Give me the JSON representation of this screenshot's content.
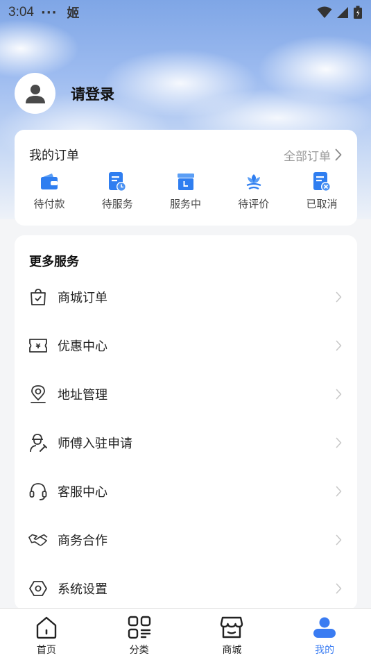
{
  "status_bar": {
    "time": "3:04",
    "dots": "···",
    "app_badge": "姬"
  },
  "profile": {
    "login_text": "请登录"
  },
  "orders": {
    "title": "我的订单",
    "all_label": "全部订单",
    "items": [
      {
        "label": "待付款",
        "icon": "wallet-icon"
      },
      {
        "label": "待服务",
        "icon": "clipboard-clock-icon"
      },
      {
        "label": "服务中",
        "icon": "box-icon"
      },
      {
        "label": "待评价",
        "icon": "flower-icon"
      },
      {
        "label": "已取消",
        "icon": "document-cancel-icon"
      }
    ]
  },
  "services": {
    "title": "更多服务",
    "items": [
      {
        "label": "商城订单",
        "icon": "shopping-bag-icon"
      },
      {
        "label": "优惠中心",
        "icon": "coupon-icon"
      },
      {
        "label": "地址管理",
        "icon": "location-pin-icon"
      },
      {
        "label": "师傅入驻申请",
        "icon": "worker-icon"
      },
      {
        "label": "客服中心",
        "icon": "headset-icon"
      },
      {
        "label": "商务合作",
        "icon": "handshake-icon"
      },
      {
        "label": "系统设置",
        "icon": "settings-hexagon-icon"
      }
    ]
  },
  "tabs": [
    {
      "label": "首页",
      "icon": "home-icon"
    },
    {
      "label": "分类",
      "icon": "category-icon"
    },
    {
      "label": "商城",
      "icon": "store-icon"
    },
    {
      "label": "我的",
      "icon": "user-icon"
    }
  ],
  "colors": {
    "accent": "#3a7cf2",
    "active_tab": "#3a7cf2"
  }
}
